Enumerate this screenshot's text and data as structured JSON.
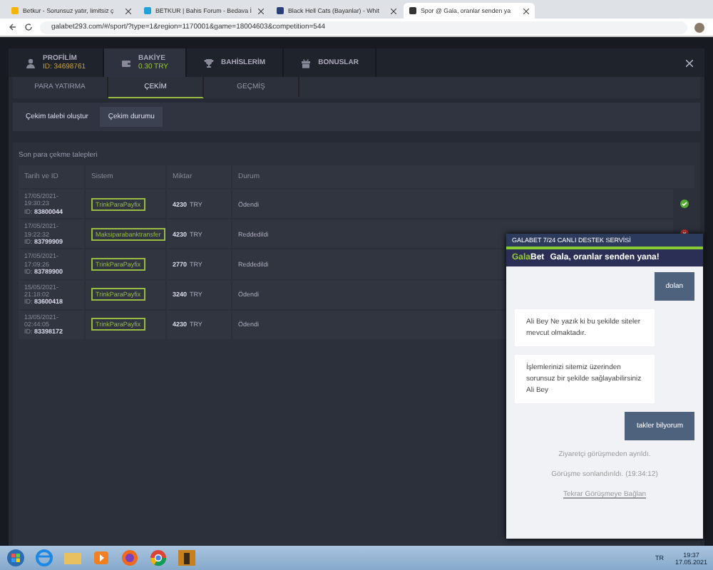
{
  "browser": {
    "tabs": [
      {
        "title": "Betkur - Sorunsuz yatır, limitsiz ç",
        "selected": false
      },
      {
        "title": "BETKUR | Bahis Forum - Bedava İ",
        "selected": false
      },
      {
        "title": "Black Hell Cats (Bayanlar) - Whit",
        "selected": false
      },
      {
        "title": "Spor @ Gala, oranlar senden ya",
        "selected": true
      }
    ],
    "url": "galabet293.com/#/sport/?type=1&region=1170001&game=18004603&competition=544"
  },
  "account_tabs": [
    {
      "label": "PROFİLİM",
      "sub": "ID: 34698761",
      "selected": false
    },
    {
      "label": "BAKİYE",
      "sub": "0.30 TRY",
      "selected": true
    },
    {
      "label": "BAHİSLERİM",
      "selected": false
    },
    {
      "label": "BONUSLAR",
      "selected": false
    }
  ],
  "section_tabs": [
    {
      "label": "PARA YATIRMA",
      "selected": false
    },
    {
      "label": "ÇEKİM",
      "selected": true
    },
    {
      "label": "GEÇMİŞ",
      "selected": false
    }
  ],
  "sub_buttons": [
    {
      "label": "Çekim talebi oluştur",
      "selected": false
    },
    {
      "label": "Çekim durumu",
      "selected": true
    }
  ],
  "table": {
    "title": "Son para çekme talepleri",
    "columns": [
      "Tarih ve ID",
      "Sistem",
      "Miktar",
      "Durum"
    ],
    "rows": [
      {
        "date": "17/05/2021-",
        "time": "19:30:23",
        "id_label": "ID:",
        "id": "83800044",
        "system": "TrinkParaPayfix",
        "amount": "4230",
        "currency": "TRY",
        "status": "Ödendi",
        "kind": "paid"
      },
      {
        "date": "17/05/2021-",
        "time": "19:22:32",
        "id_label": "ID:",
        "id": "83799909",
        "system": "Maksiparabanktransfer",
        "amount": "4230",
        "currency": "TRY",
        "status": "Reddedildi",
        "kind": "rejected"
      },
      {
        "date": "17/05/2021-",
        "time": "17:09:26",
        "id_label": "ID:",
        "id": "83789900",
        "system": "TrinkParaPayfix",
        "amount": "2770",
        "currency": "TRY",
        "status": "Reddedildi"
      },
      {
        "date": "15/05/2021-",
        "time": "21:18:02",
        "id_label": "ID:",
        "id": "83600418",
        "system": "TrinkParaPayfix",
        "amount": "3240",
        "currency": "TRY",
        "status": "Ödendi"
      },
      {
        "date": "13/05/2021-",
        "time": "02:44:05",
        "id_label": "ID:",
        "id": "83398172",
        "system": "TrinkParaPayfix",
        "amount": "4230",
        "currency": "TRY",
        "status": "Ödendi"
      }
    ]
  },
  "chat": {
    "title": "GALABET 7/24 CANLI DESTEK SERVİSİ",
    "brand_a": "Gala",
    "brand_b": "Bet",
    "slogan": "Gala, oranlar senden yana!",
    "messages": [
      {
        "kind": "visitor",
        "text": "dolan"
      },
      {
        "kind": "agent",
        "text": "Ali Bey Ne yazık ki bu şekilde siteler mevcut olmaktadır."
      },
      {
        "kind": "agent",
        "text": "İşlemlerinizi sitemiz üzerinden sorunsuz bir şekilde sağlayabilirsiniz Ali Bey"
      },
      {
        "kind": "visitor",
        "text": "takler bilyorum"
      },
      {
        "kind": "system",
        "text": "Ziyaretçi görüşmeden ayrıldı."
      },
      {
        "kind": "system",
        "text": "Görüşme sonlandırıldı. (19:34:12)"
      },
      {
        "kind": "link",
        "text": "Tekrar Görüşmeye Bağlan"
      }
    ]
  },
  "taskbar": {
    "language": "TR",
    "time": "19:37",
    "date": "17.05.2021"
  }
}
